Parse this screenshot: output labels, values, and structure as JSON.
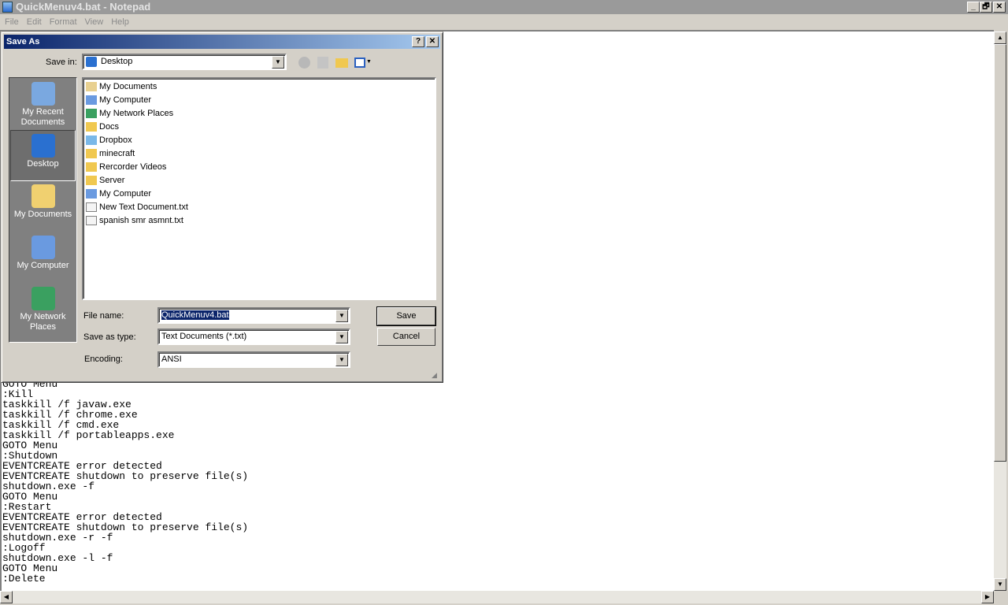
{
  "window": {
    "title": "QuickMenuv4.bat - Notepad",
    "minimize": "_",
    "restore": "🗗",
    "close": "✕"
  },
  "menu": [
    "File",
    "Edit",
    "Format",
    "View",
    "Help"
  ],
  "editor_lines": [
    "GOTO Menu",
    ":Kill",
    "taskkill /f javaw.exe",
    "taskkill /f chrome.exe",
    "taskkill /f cmd.exe",
    "taskkill /f portableapps.exe",
    "GOTO Menu",
    ":Shutdown",
    "EVENTCREATE error detected",
    "EVENTCREATE shutdown to preserve file(s)",
    "shutdown.exe -f",
    "GOTO Menu",
    ":Restart",
    "EVENTCREATE error detected",
    "EVENTCREATE shutdown to preserve file(s)",
    "shutdown.exe -r -f",
    ":Logoff",
    "shutdown.exe -l -f",
    "GOTO Menu",
    ":Delete"
  ],
  "dialog": {
    "title": "Save As",
    "help": "?",
    "close": "✕",
    "save_in_label": "Save in:",
    "save_in_value": "Desktop",
    "places": [
      {
        "label": "My Recent Documents",
        "icon": "recent-documents-icon",
        "color": "#7aa8e0"
      },
      {
        "label": "Desktop",
        "icon": "desktop-icon",
        "color": "#2a70d0",
        "selected": true
      },
      {
        "label": "My Documents",
        "icon": "my-documents-folder-icon",
        "color": "#f0d070"
      },
      {
        "label": "My Computer",
        "icon": "my-computer-icon",
        "color": "#6a9ae0"
      },
      {
        "label": "My Network Places",
        "icon": "network-places-icon",
        "color": "#3aa060"
      }
    ],
    "files": [
      {
        "name": "My Documents",
        "icon": "my-documents-icon"
      },
      {
        "name": "My Computer",
        "icon": "my-computer-icon"
      },
      {
        "name": "My Network Places",
        "icon": "network-places-icon"
      },
      {
        "name": "Docs",
        "icon": "folder-icon"
      },
      {
        "name": "Dropbox",
        "icon": "dropbox-folder-icon"
      },
      {
        "name": "minecraft",
        "icon": "folder-icon"
      },
      {
        "name": "Rercorder Videos",
        "icon": "folder-icon"
      },
      {
        "name": "Server",
        "icon": "folder-icon"
      },
      {
        "name": "My Computer",
        "icon": "shortcut-icon"
      },
      {
        "name": "New Text Document.txt",
        "icon": "text-file-icon"
      },
      {
        "name": "spanish smr asmnt.txt",
        "icon": "text-file-icon"
      }
    ],
    "file_name_label": "File name:",
    "file_name_value": "QuickMenuv4.bat",
    "save_type_label": "Save as type:",
    "save_type_value": "Text Documents (*.txt)",
    "encoding_label": "Encoding:",
    "encoding_value": "ANSI",
    "save_button": "Save",
    "cancel_button": "Cancel"
  },
  "colors": {
    "titlebar_inactive": "#9a9a9a",
    "dialog_title_start": "#0a246a",
    "dialog_title_end": "#a6caf0",
    "selection": "#0a246a"
  }
}
